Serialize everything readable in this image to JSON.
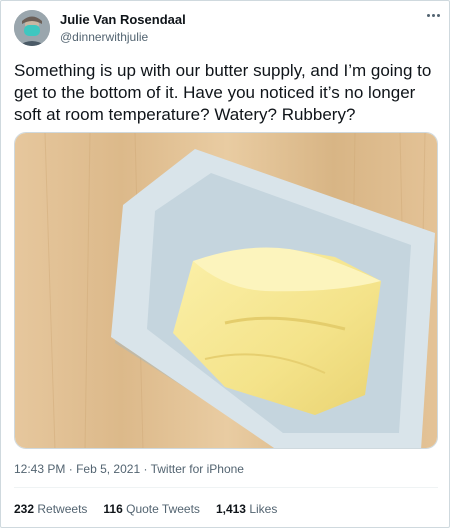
{
  "author": {
    "name": "Julie Van Rosendaal",
    "handle": "@dinnerwithjulie"
  },
  "tweet": {
    "text": "Something is up with our butter supply, and I’m going to get to the bottom of it. Have you noticed it’s no longer soft at room temperature? Watery? Rubbery?",
    "time": "12:43 PM",
    "date": "Feb 5, 2021",
    "source": "Twitter for iPhone"
  },
  "stats": {
    "retweets_count": "232",
    "retweets_label": "Retweets",
    "quotes_count": "116",
    "quotes_label": "Quote Tweets",
    "likes_count": "1,413",
    "likes_label": "Likes"
  },
  "colors": {
    "text_primary": "#0f1419",
    "text_secondary": "#536471",
    "border": "#cfd9de"
  }
}
